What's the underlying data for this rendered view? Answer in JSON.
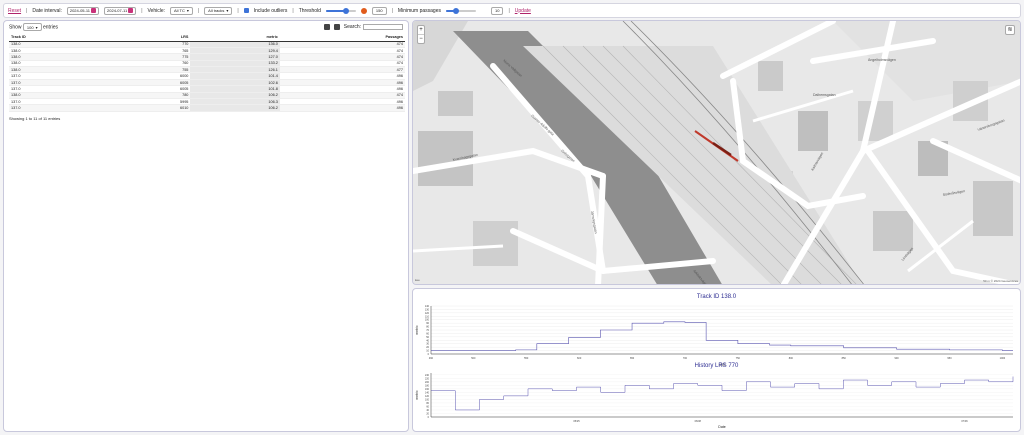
{
  "toolbar": {
    "reset": "Reset",
    "date_label": "Date interval:",
    "date_from": "2024-05-11",
    "date_to": "2024-07-11",
    "vehicle_label": "Vehicle:",
    "vehicle_value": "All TC",
    "metric_value": "All tracks",
    "include_outliers": "Include outliers",
    "threshold_label": "Threshold",
    "threshold_value": 150,
    "min_passages_label": "Minimum passages",
    "min_passages_value": 10,
    "update": "Update"
  },
  "table": {
    "show_label": "Show",
    "entries_value": "100",
    "entries_label": "entries",
    "search_label": "Search:",
    "columns": [
      "Track ID",
      "LRS",
      "metric",
      "Passages"
    ],
    "rows": [
      [
        "138.0",
        "770",
        "136.0",
        "474"
      ],
      [
        "138.0",
        "765",
        "129.4",
        "474"
      ],
      [
        "138.0",
        "775",
        "127.0",
        "474"
      ],
      [
        "138.0",
        "760",
        "133.2",
        "474"
      ],
      [
        "138.0",
        "755",
        "126.1",
        "477"
      ],
      [
        "137.0",
        "6000",
        "101.4",
        "496"
      ],
      [
        "137.0",
        "6005",
        "102.6",
        "496"
      ],
      [
        "137.0",
        "6005",
        "101.8",
        "496"
      ],
      [
        "138.0",
        "780",
        "106.2",
        "474"
      ],
      [
        "137.0",
        "5995",
        "106.3",
        "496"
      ],
      [
        "137.0",
        "6010",
        "106.2",
        "496"
      ]
    ],
    "footer": "Showing 1 to 11 of 11 entries"
  },
  "map": {
    "zoom_in": "+",
    "zoom_out": "−",
    "layers_icon": "≋",
    "attribution": "© 2024 Geoservices",
    "logo": "kee",
    "scale": "50 m",
    "labels": [
      {
        "t": "Gustav Adolfs gata"
      },
      {
        "t": "Gnistgatan"
      },
      {
        "t": "Kvarnhagsgatan"
      },
      {
        "t": "Järnvägsgatan"
      },
      {
        "t": "Ängelholmsvägen"
      },
      {
        "t": "Norra Vallgatan"
      },
      {
        "t": "Dalhemsgatan"
      },
      {
        "t": "Kalmarvägen"
      },
      {
        "t": "Vänersborgsgatan"
      },
      {
        "t": "Söderåsvägen"
      },
      {
        "t": "Arkitektvägen"
      },
      {
        "t": "Lindvägen"
      }
    ]
  },
  "chart_data": [
    {
      "type": "line",
      "title": "Track ID 138.0",
      "xlabel": "LRS",
      "ylabel": "metric",
      "xlim": [
        460,
        1010
      ],
      "ylim": [
        0,
        140
      ],
      "xticks": [
        460,
        500,
        550,
        600,
        650,
        700,
        750,
        800,
        850,
        900,
        950,
        1000
      ],
      "yticks": [
        0,
        10,
        20,
        30,
        40,
        50,
        60,
        70,
        80,
        90,
        100,
        110,
        120,
        130,
        140
      ],
      "series": [
        {
          "x": [
            460,
            500,
            540,
            560,
            590,
            620,
            650,
            680,
            700,
            720,
            750,
            780,
            800,
            850,
            900,
            950,
            1000,
            1010
          ],
          "y": [
            10,
            10,
            12,
            30,
            48,
            70,
            90,
            94,
            92,
            40,
            30,
            26,
            24,
            18,
            14,
            12,
            10,
            10
          ]
        }
      ]
    },
    {
      "type": "line",
      "title": "History LRS 770",
      "xlabel": "Date",
      "ylabel": "metric",
      "ylim": [
        0,
        250
      ],
      "xticks": [
        "05/25",
        "06/08",
        "06/22",
        "07/06"
      ],
      "yticks": [
        0,
        20,
        40,
        60,
        80,
        100,
        120,
        140,
        160,
        180,
        200,
        220,
        240
      ],
      "series": [
        {
          "x": [
            "05/11",
            "05/13",
            "05/15",
            "05/18",
            "05/20",
            "05/23",
            "05/25",
            "05/28",
            "05/31",
            "06/03",
            "06/05",
            "06/08",
            "06/11",
            "06/13",
            "06/16",
            "06/18",
            "06/21",
            "06/23",
            "06/26",
            "06/28",
            "07/01",
            "07/03",
            "07/06",
            "07/09",
            "07/11"
          ],
          "y": [
            150,
            40,
            100,
            120,
            160,
            150,
            170,
            140,
            180,
            160,
            190,
            180,
            150,
            200,
            170,
            190,
            160,
            210,
            180,
            200,
            170,
            190,
            210,
            200,
            230
          ]
        }
      ]
    }
  ],
  "colors": {
    "accent": "#b0226b",
    "line": "#5a55b0",
    "title": "#2a2a90"
  }
}
